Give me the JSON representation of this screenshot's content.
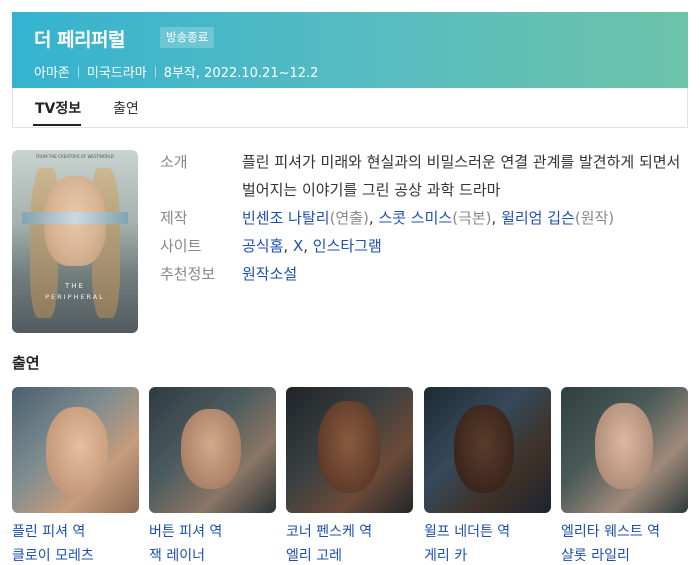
{
  "header": {
    "title": "더 페리퍼럴",
    "badge": "방송종료",
    "meta": [
      "아마존",
      "미국드라마",
      "8부작, 2022.10.21~12.2"
    ]
  },
  "tabs": [
    {
      "label": "TV정보"
    },
    {
      "label": "출연"
    }
  ],
  "poster": {
    "top_text": "FROM THE CREATORS OF WESTWORLD",
    "title_line1": "THE",
    "title_line2": "PERIPHERAL"
  },
  "info": {
    "intro_label": "소개",
    "intro_text": "플린 피셔가 미래와 현실과의 비밀스러운 연결 관계를 발견하게 되면서 벌어지는 이야기를 그린 공상 과학 드라마",
    "production_label": "제작",
    "production": [
      {
        "name": "빈센조 나탈리",
        "role": "(연출)"
      },
      {
        "name": "스콧 스미스",
        "role": "(극본)"
      },
      {
        "name": "윌리엄 깁슨",
        "role": "(원작)"
      }
    ],
    "site_label": "사이트",
    "sites": [
      "공식홈",
      "X",
      "인스타그램"
    ],
    "recommend_label": "추천정보",
    "recommend": "원작소설"
  },
  "cast": {
    "heading": "출연",
    "members": [
      {
        "role": "플린 피셔 역",
        "name": "클로이 모레츠"
      },
      {
        "role": "버튼 피셔 역",
        "name": "잭 레이너"
      },
      {
        "role": "코너 펜스케 역",
        "name": "엘리 고레"
      },
      {
        "role": "윌프 네더튼 역",
        "name": "게리 카"
      },
      {
        "role": "엘리타 웨스트 역",
        "name": "샬롯 라일리"
      }
    ]
  }
}
